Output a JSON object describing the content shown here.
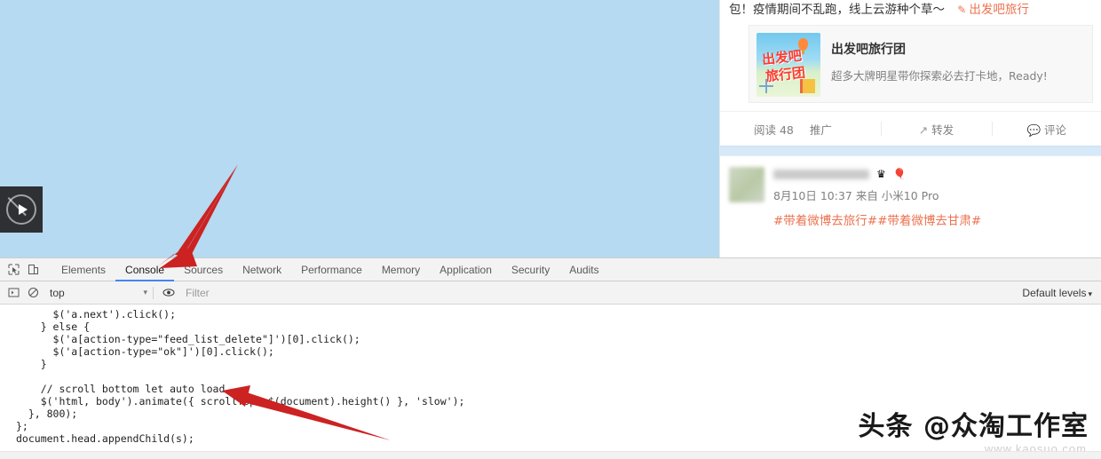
{
  "browser_page": {
    "video_player": {
      "play_icon": "play-icon",
      "label": ""
    }
  },
  "weibo": {
    "post1": {
      "text_tail": "包！疫情期间不乱跑，线上云游种个草～",
      "link_icon": "link-icon",
      "link_text": "出发吧旅行",
      "card": {
        "image_alt": "出发吧旅行团",
        "image_text_top": "出发吧",
        "image_text_bottom": "旅行团",
        "title": "出发吧旅行团",
        "desc": "超多大牌明星带你探索必去打卡地，Ready!"
      },
      "actions": {
        "read_label": "阅读 48",
        "promote_label": "推广",
        "repost_icon": "repost-icon",
        "repost_label": "转发",
        "comment_icon": "comment-icon",
        "comment_label": "评论"
      }
    },
    "post2": {
      "author_name": "",
      "badge_crown": "♛",
      "badge_balloon": "🎈",
      "meta": "8月10日 10:37 来自 小米10 Pro",
      "tags": "#带着微博去旅行##带着微博去甘肃#"
    }
  },
  "devtools": {
    "toolbar_icons": {
      "inspect": "inspect-cursor-icon",
      "device": "device-toolbar-icon"
    },
    "tabs": [
      {
        "label": "Elements",
        "active": false
      },
      {
        "label": "Console",
        "active": true
      },
      {
        "label": "Sources",
        "active": false
      },
      {
        "label": "Network",
        "active": false
      },
      {
        "label": "Performance",
        "active": false
      },
      {
        "label": "Memory",
        "active": false
      },
      {
        "label": "Application",
        "active": false
      },
      {
        "label": "Security",
        "active": false
      },
      {
        "label": "Audits",
        "active": false
      }
    ],
    "filter_bar": {
      "sidebar_icon": "console-sidebar-icon",
      "clear_icon": "clear-console-icon",
      "context": "top",
      "context_caret": "▾",
      "eye_icon": "eye-icon",
      "filter_placeholder": "Filter",
      "levels_label": "Default levels",
      "levels_caret": "▾"
    },
    "console_code": {
      "l1": "      $('a.next').click();",
      "l2": "    } else {",
      "l3": "      $('a[action-type=\"feed_list_delete\"]')[0].click();",
      "l4": "      $('a[action-type=\"ok\"]')[0].click();",
      "l5": "    }",
      "l6": "    // scroll bottom let auto load",
      "l7": "    $('html, body').animate({ scrollTop: $(document).height() }, 'slow');",
      "l8": "  }, 800);",
      "l9": "};",
      "l10": "document.head.appendChild(s);"
    }
  },
  "annotations": {
    "arrow_color": "#cc2222",
    "arrow1_target": "Console",
    "arrow2_target": "scrollTop line"
  },
  "watermarks": {
    "main": "头条 @众淘工作室",
    "sub": "www.kaosuo.com",
    "side": ""
  }
}
